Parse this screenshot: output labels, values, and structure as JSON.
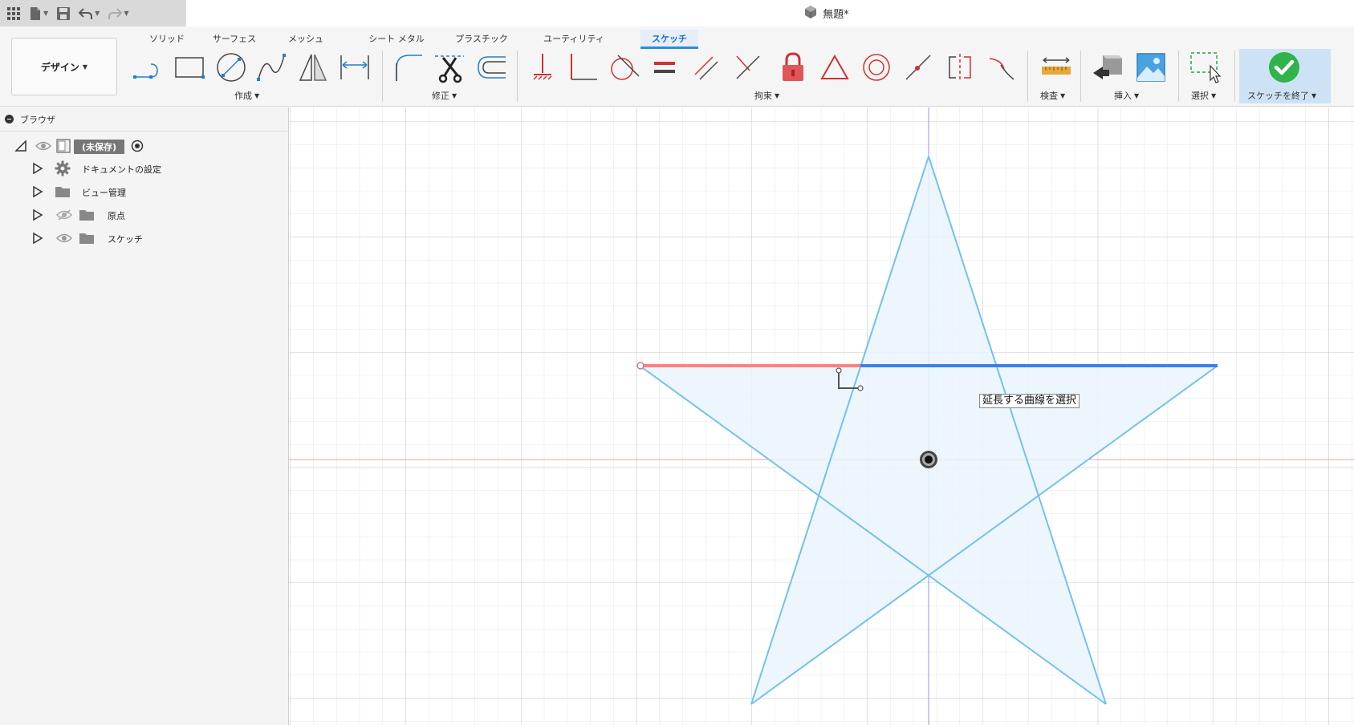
{
  "title_bar": {
    "document_title": "無題*"
  },
  "quick_access": {
    "app_menu_icon": "grid-icon",
    "file_icon": "file-icon",
    "save_icon": "save-icon",
    "undo_icon": "undo-icon",
    "redo_icon": "redo-icon"
  },
  "workspace": {
    "label": "デザイン"
  },
  "tabs": [
    {
      "label": "ソリッド",
      "active": false
    },
    {
      "label": "サーフェス",
      "active": false
    },
    {
      "label": "メッシュ",
      "active": false
    },
    {
      "label": "シート メタル",
      "active": false
    },
    {
      "label": "プラスチック",
      "active": false
    },
    {
      "label": "ユーティリティ",
      "active": false
    },
    {
      "label": "スケッチ",
      "active": true
    }
  ],
  "groups": {
    "create": "作成",
    "modify": "修正",
    "constraints": "拘束",
    "inspect": "検査",
    "insert": "挿入",
    "select": "選択",
    "finish": "スケッチを終了"
  },
  "browser": {
    "title": "ブラウザ",
    "root_label": "(未保存)",
    "items": [
      {
        "label": "ドキュメントの設定",
        "icon": "gear-icon"
      },
      {
        "label": "ビュー管理",
        "icon": "folder-icon"
      },
      {
        "label": "原点",
        "icon": "folder-icon",
        "visibility": "hidden-eye-icon"
      },
      {
        "label": "スケッチ",
        "icon": "folder-icon",
        "visibility": "eye-icon"
      }
    ]
  },
  "canvas": {
    "tooltip": "延長する曲線を選択"
  },
  "colors": {
    "accent": "#2f8cd6",
    "sketch_line": "#74c1ea",
    "sketch_fill": "#e9f4fb",
    "highlight_line": "#3a7ff0",
    "extension_preview": "#ff8080",
    "origin_axis_x": "#f0a0a0",
    "origin_axis_y": "#9090ff",
    "lock_red": "#e05555",
    "finish_green": "#2fb34a"
  }
}
